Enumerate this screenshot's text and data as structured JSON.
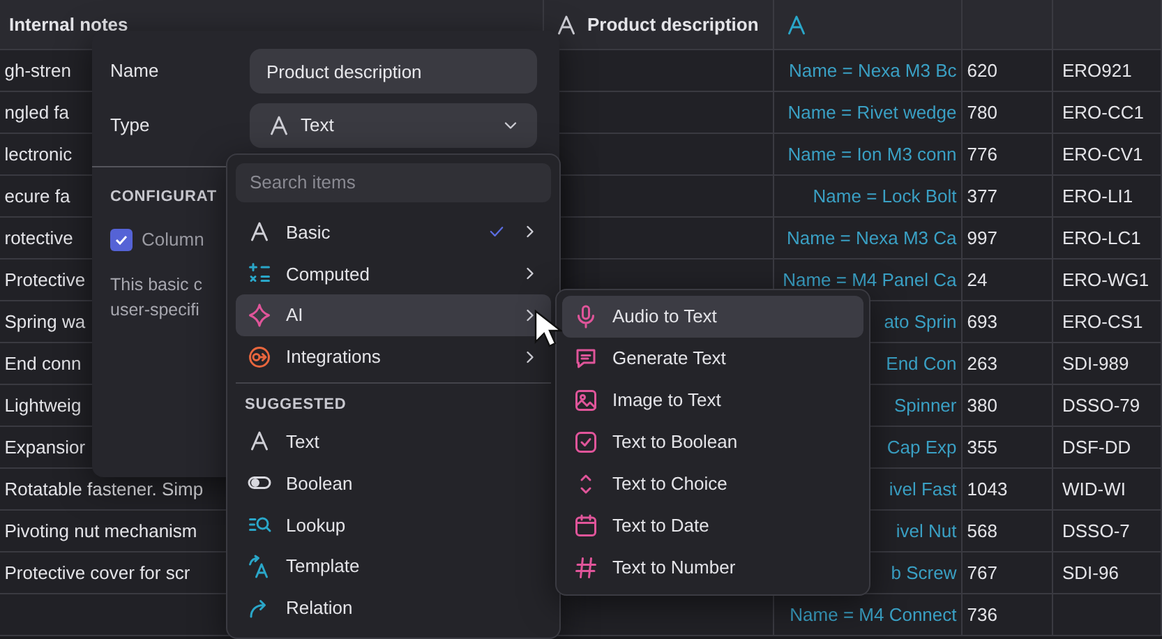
{
  "table": {
    "columns": [
      {
        "label": "Internal notes",
        "kind": "plain"
      },
      {
        "label": "Product description",
        "kind": "text"
      },
      {
        "kind": "lookup"
      }
    ],
    "rows": [
      {
        "internal_notes": "gh-stren",
        "lookup": "Name = Nexa M3 Bc",
        "number": "620",
        "code": "ERO921"
      },
      {
        "internal_notes": "ngled fa",
        "lookup": "Name = Rivet wedge",
        "number": "780",
        "code": "ERO-CC1"
      },
      {
        "internal_notes": "lectronic",
        "lookup": "Name = Ion M3 conn",
        "number": "776",
        "code": "ERO-CV1"
      },
      {
        "internal_notes": "ecure fa",
        "lookup": "Name = Lock Bolt",
        "number": "377",
        "code": "ERO-LI1"
      },
      {
        "internal_notes": "rotective",
        "lookup": "Name = Nexa M3 Ca",
        "number": "997",
        "code": "ERO-LC1"
      },
      {
        "internal_notes": "Protective",
        "lookup": "Name = M4 Panel Ca",
        "number": "24",
        "code": "ERO-WG1"
      },
      {
        "internal_notes": "Spring wa",
        "lookup": "ato Sprin",
        "number": "693",
        "code": "ERO-CS1"
      },
      {
        "internal_notes": "End conn",
        "lookup": "End Con",
        "number": "263",
        "code": "SDI-989"
      },
      {
        "internal_notes": "Lightweig",
        "lookup": "Spinner",
        "number": "380",
        "code": "DSSO-79"
      },
      {
        "internal_notes": "Expansior",
        "lookup": "Cap Exp",
        "number": "355",
        "code": "DSF-DD"
      },
      {
        "internal_notes": "Rotatable fastener. Simp",
        "lookup": "ivel Fast",
        "number": "1043",
        "code": "WID-WI"
      },
      {
        "internal_notes": "Pivoting nut mechanism",
        "lookup": "ivel Nut",
        "number": "568",
        "code": "DSSO-7"
      },
      {
        "internal_notes": "Protective cover for scr",
        "lookup": "b Screw",
        "number": "767",
        "code": "SDI-96"
      },
      {
        "lookup": "Name = M4 Connect",
        "number": "736"
      }
    ]
  },
  "field_dialog": {
    "name_label": "Name",
    "name_value": "Product description",
    "type_label": "Type",
    "type_value": "Text",
    "configuration_heading": "CONFIGURAT",
    "checkbox": {
      "label": "Column",
      "checked": true
    },
    "description_lines": [
      "This basic c",
      "user-specifi"
    ]
  },
  "type_menu": {
    "search_placeholder": "Search items",
    "categories": [
      {
        "label": "Basic",
        "kind": "basic",
        "checked": true,
        "selected": false
      },
      {
        "label": "Computed",
        "kind": "computed",
        "checked": false,
        "selected": false
      },
      {
        "label": "AI",
        "kind": "ai",
        "checked": false,
        "selected": true
      },
      {
        "label": "Integrations",
        "kind": "integrations",
        "checked": false,
        "selected": false
      }
    ],
    "suggested_heading": "SUGGESTED",
    "suggested": [
      {
        "label": "Text",
        "kind": "text"
      },
      {
        "label": "Boolean",
        "kind": "boolean"
      },
      {
        "label": "Lookup",
        "kind": "lookup"
      },
      {
        "label": "Template",
        "kind": "template"
      },
      {
        "label": "Relation",
        "kind": "relation"
      }
    ]
  },
  "ai_submenu": {
    "items": [
      {
        "label": "Audio to Text",
        "kind": "audio",
        "selected": true
      },
      {
        "label": "Generate Text",
        "kind": "generate",
        "selected": false
      },
      {
        "label": "Image to Text",
        "kind": "image",
        "selected": false
      },
      {
        "label": "Text to Boolean",
        "kind": "bool",
        "selected": false
      },
      {
        "label": "Text to Choice",
        "kind": "choice",
        "selected": false
      },
      {
        "label": "Text to Date",
        "kind": "date",
        "selected": false
      },
      {
        "label": "Text to Number",
        "kind": "number",
        "selected": false
      }
    ]
  }
}
